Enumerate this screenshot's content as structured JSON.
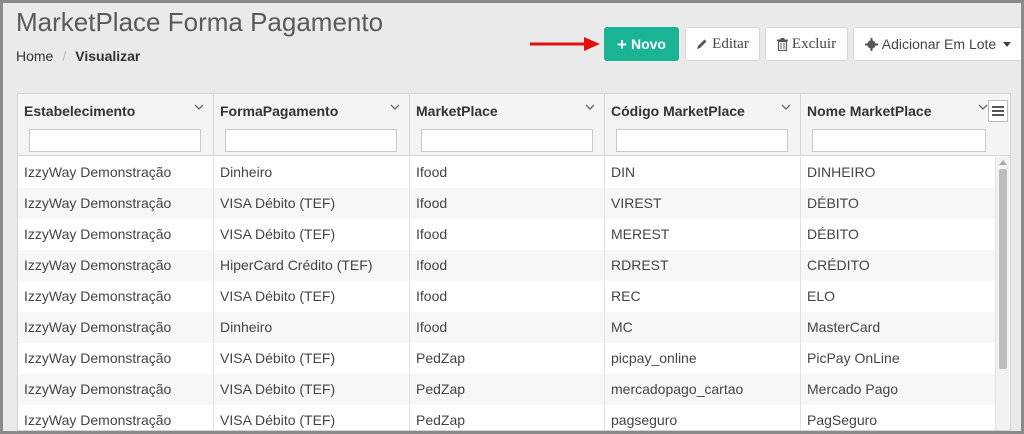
{
  "page": {
    "title": "MarketPlace Forma Pagamento"
  },
  "breadcrumb": {
    "home": "Home",
    "separator": "/",
    "current": "Visualizar"
  },
  "toolbar": {
    "new_label": "Novo",
    "edit_label": "Editar",
    "delete_label": "Excluir",
    "batch_label": "Adicionar Em Lote",
    "accent_color": "#1ab394",
    "arrow_color": "#e01010"
  },
  "grid": {
    "columns": [
      {
        "label": "Estabelecimento",
        "filter": ""
      },
      {
        "label": "FormaPagamento",
        "filter": ""
      },
      {
        "label": "MarketPlace",
        "filter": ""
      },
      {
        "label": "Código MarketPlace",
        "filter": ""
      },
      {
        "label": "Nome MarketPlace",
        "filter": ""
      }
    ],
    "rows": [
      [
        "IzzyWay Demonstração",
        "Dinheiro",
        "Ifood",
        "DIN",
        "DINHEIRO"
      ],
      [
        "IzzyWay Demonstração",
        "VISA Débito (TEF)",
        "Ifood",
        "VIREST",
        "DÉBITO"
      ],
      [
        "IzzyWay Demonstração",
        "VISA Débito (TEF)",
        "Ifood",
        "MEREST",
        "DÉBITO"
      ],
      [
        "IzzyWay Demonstração",
        "HiperCard Crédito (TEF)",
        "Ifood",
        "RDREST",
        "CRÉDITO"
      ],
      [
        "IzzyWay Demonstração",
        "VISA Débito (TEF)",
        "Ifood",
        "REC",
        "ELO"
      ],
      [
        "IzzyWay Demonstração",
        "Dinheiro",
        "Ifood",
        "MC",
        "MasterCard"
      ],
      [
        "IzzyWay Demonstração",
        "VISA Débito (TEF)",
        "PedZap",
        "picpay_online",
        "PicPay OnLine"
      ],
      [
        "IzzyWay Demonstração",
        "VISA Débito (TEF)",
        "PedZap",
        "mercadopago_cartao",
        "Mercado Pago"
      ],
      [
        "IzzyWay Demonstração",
        "VISA Débito (TEF)",
        "PedZap",
        "pagseguro",
        "PagSeguro"
      ]
    ]
  }
}
